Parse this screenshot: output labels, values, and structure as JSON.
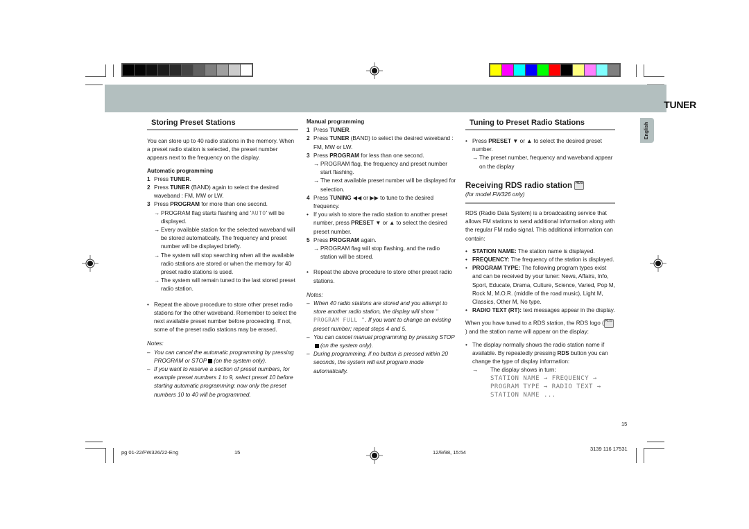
{
  "header": {
    "section_title": "TUNER",
    "language_tab": "English",
    "grayscale_swatches": [
      "#000000",
      "#050505",
      "#101010",
      "#1c1c1c",
      "#2a2a2a",
      "#444444",
      "#606060",
      "#808080",
      "#a0a0a0",
      "#cccccc",
      "#ffffff"
    ],
    "color_swatches": [
      "#ffff00",
      "#ff00ff",
      "#00ffff",
      "#0000ff",
      "#00ff00",
      "#ff0000",
      "#000000",
      "#ffff80",
      "#ff80ff",
      "#80ffff",
      "#808080"
    ],
    "band_color": "#b3bfbf"
  },
  "col1": {
    "title": "Storing Preset Stations",
    "intro": "You can store up to 40 radio stations in the memory. When a preset radio station is selected, the preset number appears next to the frequency on the display.",
    "auto_title": "Automatic programming",
    "steps": [
      {
        "n": "1",
        "pre": "Press ",
        "bold": "TUNER",
        "post": "."
      },
      {
        "n": "2",
        "pre": "Press ",
        "bold": "TUNER",
        "post": " (BAND) again to select the desired waveband : FM, MW or LW."
      },
      {
        "n": "3",
        "pre": "Press ",
        "bold": "PROGRAM",
        "post": " for more than one second."
      }
    ],
    "arrows": [
      {
        "pre": "PROGRAM flag starts flashing and '",
        "lcd": "AUTO",
        "post": "' will be displayed."
      },
      {
        "pre": "Every available station for the selected waveband will be stored automatically. The frequency and preset number will be displayed briefly.",
        "lcd": "",
        "post": ""
      },
      {
        "pre": "The system  will stop searching when all the available radio stations are stored or when the memory for 40 preset radio stations is used.",
        "lcd": "",
        "post": ""
      },
      {
        "pre": "The system will remain tuned to the last stored preset radio station.",
        "lcd": "",
        "post": ""
      }
    ],
    "bullet": "Repeat the above procedure to store other preset radio stations for the other waveband. Remember to select the next available preset number before proceeding. If not, some of the preset radio stations may be erased.",
    "notes_title": "Notes:",
    "notes": [
      {
        "pre": "You can cancel the automatic programming by pressing PROGRAM or STOP",
        "post": "(on the system only)."
      },
      {
        "pre": "If you want to reserve a section of  preset numbers, for example preset numbers 1 to 9, select preset 10 before starting automatic programming: now only the preset numbers 10 to 40 will be programmed.",
        "post": ""
      }
    ]
  },
  "col2": {
    "manual_title": "Manual programming",
    "steps": [
      {
        "n": "1",
        "pre": "Press ",
        "bold": "TUNER",
        "post": "."
      },
      {
        "n": "2",
        "pre": "Press ",
        "bold": "TUNER",
        "post": " (BAND) to select the desired waveband : FM, MW or LW."
      },
      {
        "n": "3",
        "pre": "Press ",
        "bold": "PROGRAM",
        "post": " for less than one second."
      }
    ],
    "step3_arrows": [
      "PROGRAM flag, the frequency and preset number start flashing.",
      "The next available preset number will be displayed for selection."
    ],
    "step4": {
      "n": "4",
      "pre": "Press ",
      "bold": "TUNING",
      "post": " ◀◀ or ▶▶ to tune to the desired frequency."
    },
    "bullet1": {
      "pre": "If you wish to store the radio station to another preset number, press ",
      "bold": "PRESET",
      "post": " ▼ or ▲ to select the desired preset number."
    },
    "step5": {
      "n": "5",
      "pre": "Press ",
      "bold": "PROGRAM",
      "post": " again."
    },
    "step5_arrow": "PROGRAM flag will stop flashing, and the radio station will be stored.",
    "bullet2": "Repeat the above procedure to store other preset radio stations.",
    "notes_title": "Notes:",
    "note1_pre": "When 40 radio stations are stored and you attempt to store another radio station, the display will show",
    "note1_lcd": "\" PROGRAM FULL \"",
    "note1_post": ". If you want to change an existing preset number; repeat steps 4 and 5.",
    "note2_pre": "You can cancel manual programming by pressing STOP",
    "note2_post": "(on the system only).",
    "note3": "During programming,  if no button is pressed within 20 seconds, the system will exit program mode automatically."
  },
  "col3": {
    "title": "Tuning to Preset Radio Stations",
    "bullet1": {
      "pre": "Press ",
      "bold": "PRESET",
      "post": " ▼ or ▲ to select the desired preset number."
    },
    "arrow1": "The preset number, frequency and waveband appear on the display",
    "rds_title": "Receiving RDS radio station",
    "rds_logo": "RDS",
    "rds_model": "(for model FW326 only)",
    "rds_intro": "RDS (Radio Data System) is a broadcasting service that allows FM stations to send additional information along with the regular FM radio signal. This additional information can contain:",
    "features": [
      {
        "bold": "STATION NAME:",
        "text": " The station name is displayed."
      },
      {
        "bold": "FREQUENCY:",
        "text": " The frequency of the station is displayed."
      },
      {
        "bold": "PROGRAM  TYPE:",
        "text": " The following program types exist and can be received by your tuner: News, Affairs, Info, Sport, Educate, Drama, Culture, Science, Varied, Pop M, Rock M, M.O.R. (middle of the road music), Light M, Classics, Other M, No type."
      },
      {
        "bold": "RADIO TEXT (RT):",
        "text": " text messages appear in the display."
      }
    ],
    "tuned_pre": "When you have tuned to a RDS station, the RDS logo (",
    "tuned_post": ") and the station name will appear on the display:",
    "bullet2": {
      "pre": "The display normally shows the radio station name if available. By repeatedly pressing ",
      "bold": "RDS",
      "post": " button you can change the type of display information:"
    },
    "arrow2": "The display shows in turn:",
    "lcd_line1": "STATION NAME → FREQUENCY →",
    "lcd_line2": "PROGRAM TYPE → RADIO TEXT →",
    "lcd_line3": "STATION NAME ..."
  },
  "footer": {
    "page_number": "15",
    "file_name": "pg 01-22/FW326/22-Eng",
    "file_page": "15",
    "timestamp": "12/9/98, 15:54",
    "code": "3139 116 17531"
  }
}
